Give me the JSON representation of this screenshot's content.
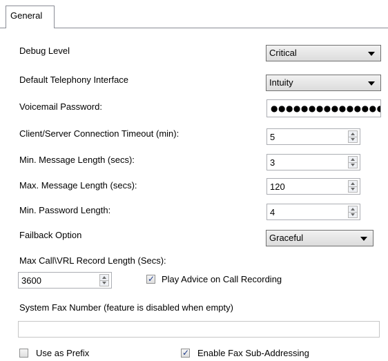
{
  "tabs": [
    {
      "label": "General",
      "active": true
    }
  ],
  "fields": {
    "debug_level": {
      "label": "Debug Level",
      "value": "Critical"
    },
    "default_telephony": {
      "label": "Default Telephony Interface",
      "value": "Intuity"
    },
    "voicemail_password": {
      "label": "Voicemail Password:",
      "value": "●●●●●●●●●●●●●●●●"
    },
    "conn_timeout": {
      "label": "Client/Server Connection Timeout (min):",
      "value": "5"
    },
    "min_msg_len": {
      "label": "Min. Message Length (secs):",
      "value": "3"
    },
    "max_msg_len": {
      "label": "Max. Message Length (secs):",
      "value": "120"
    },
    "min_pwd_len": {
      "label": "Min. Password Length:",
      "value": "4"
    },
    "failback": {
      "label": "Failback Option",
      "value": "Graceful"
    },
    "max_record_len": {
      "label": "Max Call\\VRL Record Length (Secs):",
      "value": "3600"
    },
    "play_advice": {
      "label": "Play Advice on Call Recording",
      "checked": true
    },
    "fax_number": {
      "label": "System Fax Number (feature is disabled when empty)",
      "value": ""
    },
    "use_as_prefix": {
      "label": "Use as Prefix",
      "checked": false
    },
    "fax_sub_addressing": {
      "label": "Enable Fax Sub-Addressing",
      "checked": true
    }
  },
  "colors": {
    "border": "#898c95",
    "check": "#1e3b8a"
  }
}
